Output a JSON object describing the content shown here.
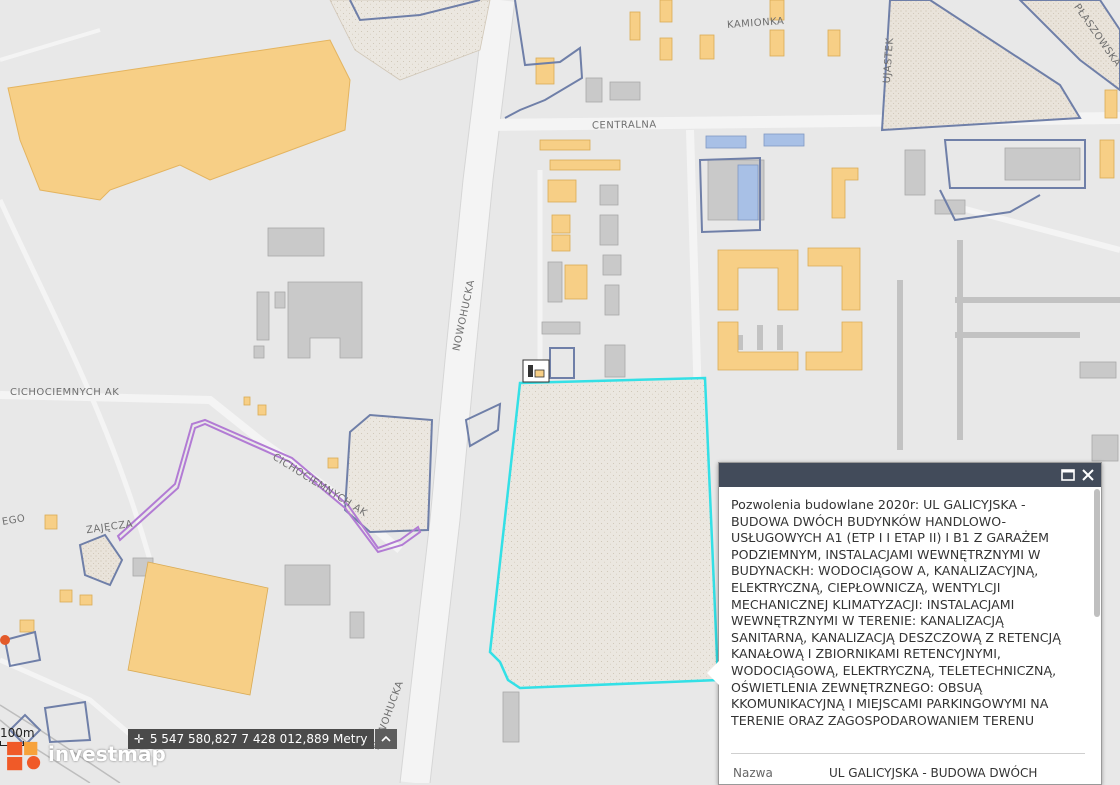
{
  "streets": {
    "kamionka": "KAMIONKA",
    "centralna": "CENTRALNA",
    "nowohucka_north": "NOWOHUCKA",
    "nowohucka_south": "NOWOHUCKA",
    "cichociemnych_west": "CICHOCIEMNYCH AK",
    "cichociemnych_diag": "CICHOCIEMNYCH AK",
    "zajecza": "ZAJĘCZA",
    "ego_fragment": "EGO",
    "ujastek_fragment": "UJASTEK",
    "plaszowska_fragment": "PŁASZOWSKA"
  },
  "popup": {
    "text": "Pozwolenia budowlane 2020r: UL GALICYJSKA - BUDOWA DWÓCH BUDYNKÓW HANDLOWO-USŁUGOWYCH A1 (ETP I I ETAP II) I B1 Z GARAŻEM PODZIEMNYM, INSTALACJAMI WEWNĘTRZNYMI W BUDYNACKH: WODOCIĄGOW A, KANALIZACYJNĄ, ELEKTRYCZNĄ, CIEPŁOWNICZĄ, WENTYLCJI MECHANICZNEJ KLIMATYZACJI: INSTALACJAMI WEWNĘTRZNYMI W TERENIE: KANALIZACJĄ SANITARNĄ, KANALIZACJĄ DESZCZOWĄ Z RETENCJĄ KANAŁOWĄ I ZBIORNIKAMI RETENCYJNYMI, WODOCIĄGOWĄ, ELEKTRYCZNĄ, TELETECHNICZNĄ, OŚWIETLENIA ZEWNĘTRZNEGO: OBSUĄ KKOMUNIKACYJNĄ I MIEJSCAMI PARKINGOWYMI NA TERENIE ORAZ ZAGOSPODAROWANIEM TERENU",
    "attr_label": "Nazwa",
    "attr_value": "UL GALICYJSKA - BUDOWA DWÓCH",
    "maximize_icon": "maximize-icon",
    "close_icon": "close-icon"
  },
  "coordinates": {
    "text": "5 547 580,827 7 428 012,889 Metry",
    "locate_icon": "crosshair-icon",
    "toggle_icon": "chevron-up-icon"
  },
  "scale": {
    "label": "100m"
  },
  "logo": {
    "text": "investmap"
  },
  "colors": {
    "background": "#e8e8e8",
    "building_grey": "#c9c9c9",
    "building_orange": "#f7cf86",
    "parcel_outline": "#6f7fa8",
    "plot_outline": "#33e0e6",
    "purple_boundary": "#b27bd4",
    "popup_header": "#424b5a"
  }
}
